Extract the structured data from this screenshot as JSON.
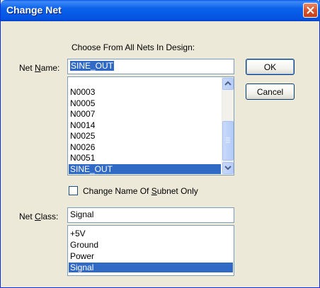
{
  "window": {
    "title": "Change Net"
  },
  "dialog": {
    "heading": "Choose From All Nets In Design:",
    "net_name_label_pre": "Net ",
    "net_name_label_ul": "N",
    "net_name_label_post": "ame:",
    "net_name_value": "SINE_OUT",
    "net_list": [
      "N0003",
      "N0005",
      "N0007",
      "N0014",
      "N0025",
      "N0026",
      "N0051",
      "SINE_OUT"
    ],
    "net_list_selected": "SINE_OUT",
    "ok_label": "OK",
    "cancel_label": "Cancel",
    "subnet_label_pre": "Change Name Of ",
    "subnet_label_ul": "S",
    "subnet_label_post": "ubnet  Only",
    "subnet_checked": false,
    "net_class_label_pre": "Net ",
    "net_class_label_ul": "C",
    "net_class_label_post": "lass:",
    "net_class_value": "Signal",
    "class_list": [
      "+5V",
      "Ground",
      "Power",
      "Signal"
    ],
    "class_list_selected": "Signal"
  }
}
